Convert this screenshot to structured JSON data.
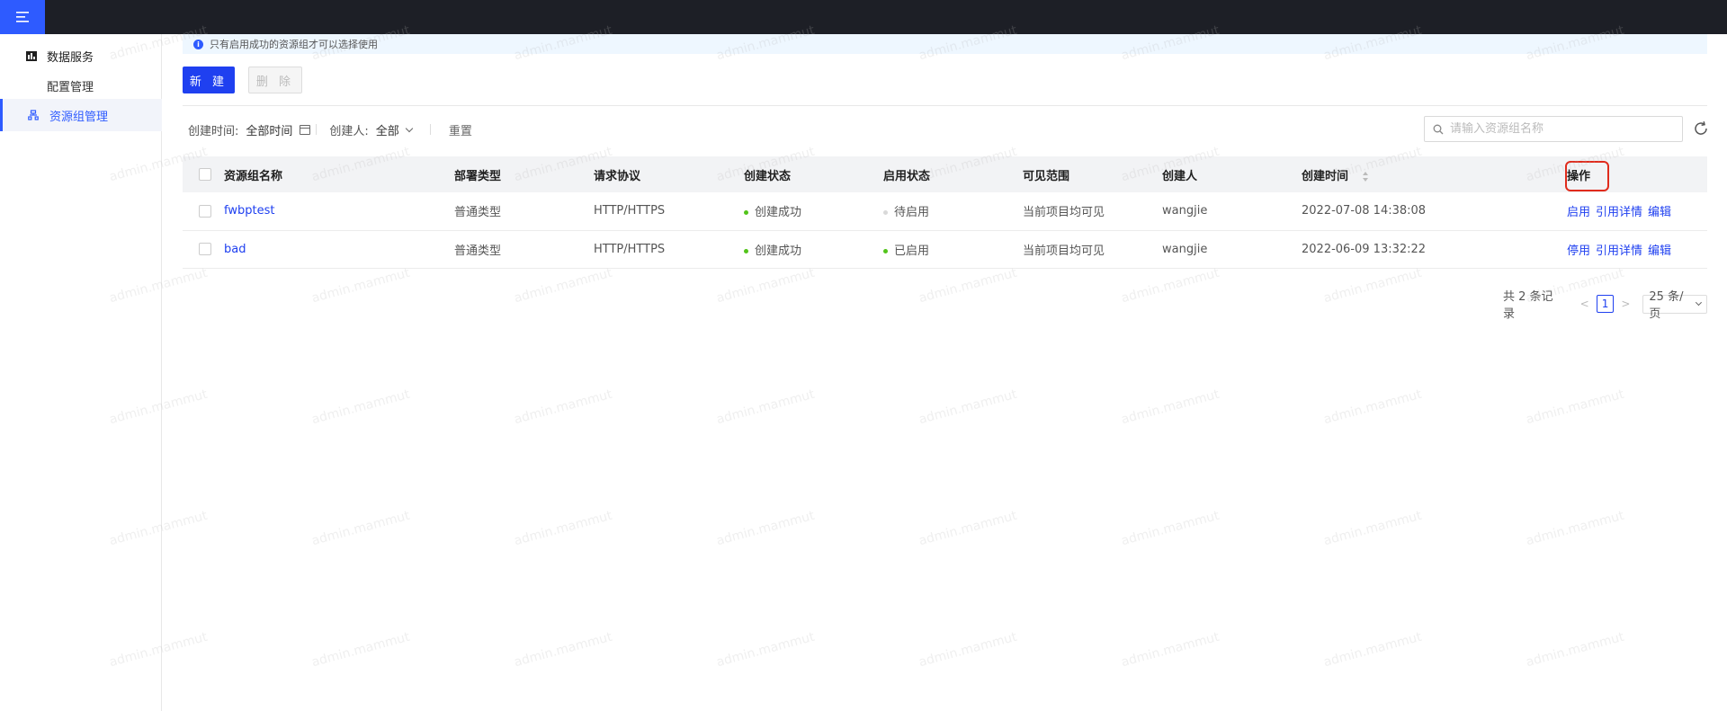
{
  "app": {
    "menu_icon": "hamburger-menu-icon",
    "accent": "#2e5bff"
  },
  "sidebar": {
    "group_label": "数据服务",
    "group_icon": "data-service-icon",
    "sub_item": "配置管理",
    "active_item": "资源组管理",
    "active_icon": "resource-group-icon"
  },
  "notice": "只有启用成功的资源组才可以选择使用",
  "toolbar": {
    "new_label": "新 建",
    "delete_label": "删 除"
  },
  "filters": {
    "created_time_label": "创建时间:",
    "created_time_value": "全部时间",
    "creator_label": "创建人:",
    "creator_value": "全部",
    "reset_label": "重置"
  },
  "search": {
    "placeholder": "请输入资源组名称"
  },
  "table": {
    "headers": [
      "资源组名称",
      "部署类型",
      "请求协议",
      "创建状态",
      "启用状态",
      "可见范围",
      "创建人",
      "创建时间",
      "操作"
    ],
    "rows": [
      {
        "name": "fwbptest",
        "deploy_type": "普通类型",
        "protocol": "HTTP/HTTPS",
        "create_status": "创建成功",
        "create_status_color": "#52c41a",
        "enable_status": "待启用",
        "enable_status_color": "#d9d9d9",
        "visibility": "当前项目均可见",
        "creator": "wangjie",
        "created_at": "2022-07-08 14:38:08",
        "actions": [
          "启用",
          "引用详情",
          "编辑"
        ]
      },
      {
        "name": "bad",
        "deploy_type": "普通类型",
        "protocol": "HTTP/HTTPS",
        "create_status": "创建成功",
        "create_status_color": "#52c41a",
        "enable_status": "已启用",
        "enable_status_color": "#52c41a",
        "visibility": "当前项目均可见",
        "creator": "wangjie",
        "created_at": "2022-06-09 13:32:22",
        "actions": [
          "停用",
          "引用详情",
          "编辑"
        ]
      }
    ]
  },
  "pagination": {
    "total_text": "共 2 条记录",
    "current_page": "1",
    "page_size": "25 条/页"
  },
  "watermark": "admin.mammut"
}
